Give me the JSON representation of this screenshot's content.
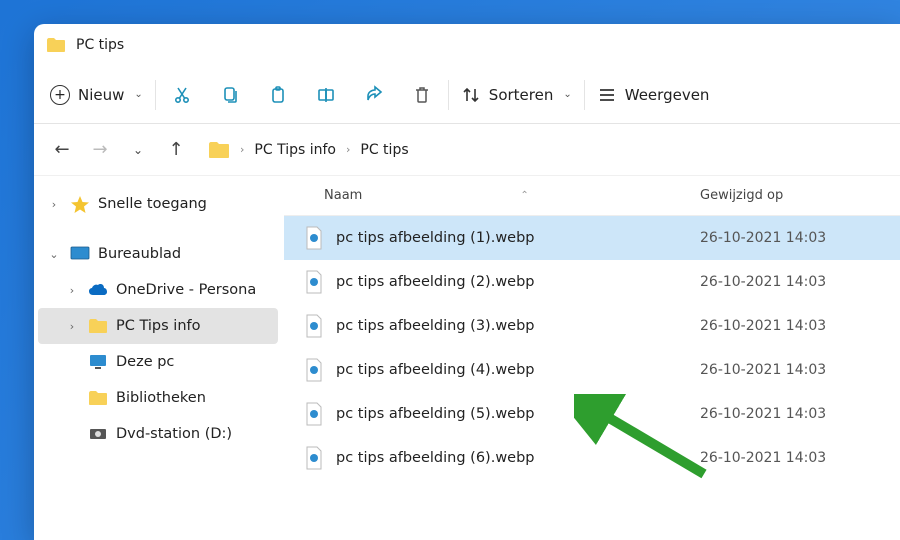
{
  "window": {
    "title": "PC tips"
  },
  "toolbar": {
    "new": "Nieuw",
    "sort": "Sorteren",
    "view": "Weergeven"
  },
  "breadcrumb": {
    "parent": "PC Tips info",
    "current": "PC tips"
  },
  "sidebar": {
    "quick": "Snelle toegang",
    "desktop": "Bureaublad",
    "onedrive": "OneDrive - Persona",
    "pctips": "PC Tips info",
    "thispc": "Deze pc",
    "libraries": "Bibliotheken",
    "dvd": "Dvd-station (D:)"
  },
  "columns": {
    "name": "Naam",
    "modified": "Gewijzigd op"
  },
  "files": [
    {
      "name": "pc tips afbeelding (1).webp",
      "date": "26-10-2021 14:03"
    },
    {
      "name": "pc tips afbeelding (2).webp",
      "date": "26-10-2021 14:03"
    },
    {
      "name": "pc tips afbeelding (3).webp",
      "date": "26-10-2021 14:03"
    },
    {
      "name": "pc tips afbeelding (4).webp",
      "date": "26-10-2021 14:03"
    },
    {
      "name": "pc tips afbeelding (5).webp",
      "date": "26-10-2021 14:03"
    },
    {
      "name": "pc tips afbeelding (6).webp",
      "date": "26-10-2021 14:03"
    }
  ],
  "colors": {
    "accent": "#1d90b8",
    "selection": "#cde6f9",
    "arrow": "#2e9e2e"
  }
}
